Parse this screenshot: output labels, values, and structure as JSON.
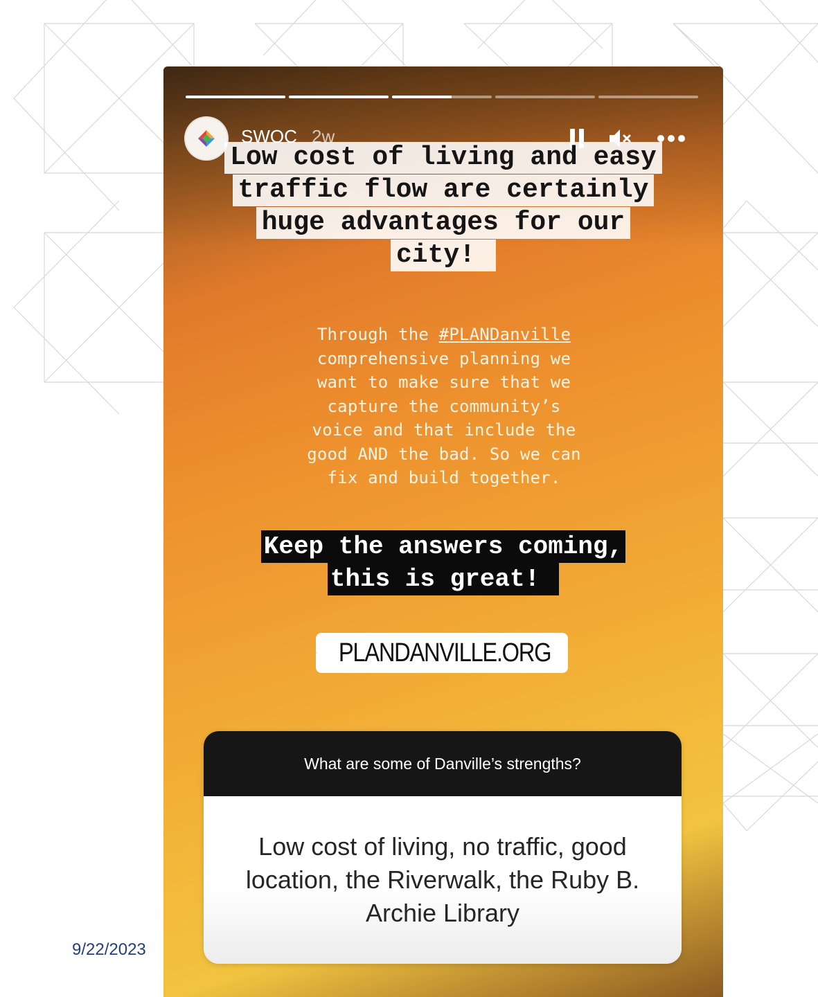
{
  "slide": {
    "date": "9/22/2023"
  },
  "story": {
    "progress": [
      1,
      1,
      0.6,
      0,
      0
    ],
    "account_name": "SWOC",
    "post_age": "2w",
    "headline_lines": [
      "Low cost of living and easy",
      "traffic flow are certainly",
      "huge advantages for our",
      "city!"
    ],
    "body": {
      "line1_prefix": "Through the ",
      "hashtag": "#PLANDanville",
      "rest_lines": [
        "comprehensive planning we",
        "want to make sure that we",
        "capture the community’s",
        "voice and that include the",
        "good AND the bad. So we can",
        "fix and build together."
      ]
    },
    "cta_lines": [
      "Keep the answers coming,",
      "this is great!"
    ],
    "link_sticker": {
      "label": "PLANDANVILLE.ORG",
      "icon": "link-icon",
      "icon_color": "#d6249f"
    },
    "question": {
      "prompt": "What are some of Danville’s strengths?",
      "answer": "Low cost of living, no traffic, good location, the Riverwalk, the Ruby B. Archie Library"
    },
    "icons": [
      "pause-icon",
      "mute-icon",
      "more-icon"
    ]
  }
}
